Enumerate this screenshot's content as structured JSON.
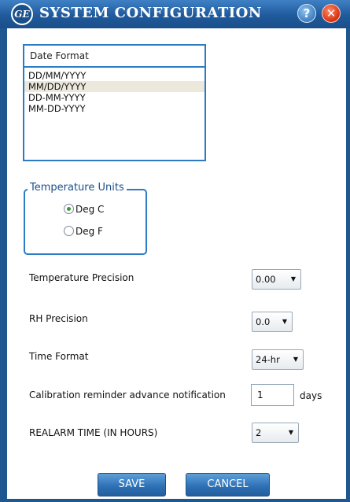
{
  "window": {
    "title": "SYSTEM CONFIGURATION",
    "logo_text": "GE",
    "help_label": "?",
    "close_label": "✕"
  },
  "date_format": {
    "header": "Date Format",
    "options": [
      "DD/MM/YYYY",
      "MM/DD/YYYY",
      "DD-MM-YYYY",
      "MM-DD-YYYY"
    ],
    "selected": "MM/DD/YYYY"
  },
  "temperature_units": {
    "legend": "Temperature Units",
    "options": [
      "Deg C",
      "Deg F"
    ],
    "selected": "Deg C"
  },
  "settings": {
    "temp_precision_label": "Temperature Precision",
    "temp_precision_value": "0.00",
    "rh_precision_label": "RH Precision",
    "rh_precision_value": "0.0",
    "time_format_label": "Time Format",
    "time_format_value": "24-hr",
    "calibration_label": "Calibration reminder advance notification",
    "calibration_value": "1",
    "calibration_unit": "days",
    "realarm_label": "REALARM TIME (IN HOURS)",
    "realarm_value": "2",
    "dropdown_arrow": "▼"
  },
  "buttons": {
    "save": "SAVE",
    "cancel": "CANCEL"
  },
  "colors": {
    "titlebar": "#1f5a9c",
    "accent": "#2c7bc4",
    "selected_row": "#ece8dc",
    "radio_checked": "#3a9a3a",
    "close": "#d6300f"
  }
}
